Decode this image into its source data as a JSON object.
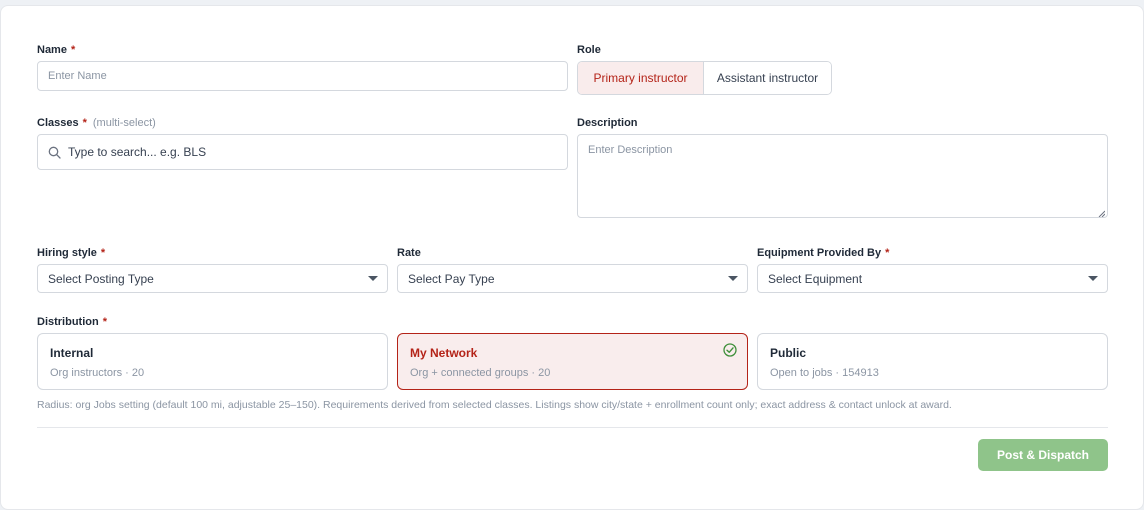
{
  "form": {
    "name": {
      "label": "Name",
      "required": "*",
      "placeholder": "Enter Name"
    },
    "role": {
      "label": "Role",
      "options": [
        "Primary instructor",
        "Assistant instructor"
      ],
      "selected": "Primary instructor"
    },
    "classes": {
      "label": "Classes",
      "required": "*",
      "hint": "(multi-select)",
      "placeholder": "Type to search... e.g. BLS",
      "icon": "search-icon"
    },
    "description": {
      "label": "Description",
      "placeholder": "Enter Description"
    },
    "hiring_style": {
      "label": "Hiring style",
      "required": "*",
      "value": "Select Posting Type"
    },
    "rate": {
      "label": "Rate",
      "value": "Select Pay Type"
    },
    "equipment": {
      "label": "Equipment Provided By",
      "required": "*",
      "value": "Select Equipment"
    },
    "distribution": {
      "label": "Distribution",
      "required": "*",
      "options": [
        {
          "title": "Internal",
          "subtitle": "Org instructors · 20",
          "selected": false
        },
        {
          "title": "My Network",
          "subtitle": "Org + connected groups · 20",
          "selected": true,
          "icon": "check-circle-icon"
        },
        {
          "title": "Public",
          "subtitle": "Open to jobs · 154913",
          "selected": false
        }
      ],
      "note": "Radius: org Jobs setting (default 100 mi, adjustable 25–150). Requirements derived from selected classes. Listings show city/state + enrollment count only; exact address & contact unlock at award."
    },
    "submit_label": "Post & Dispatch"
  },
  "colors": {
    "accent": "#b42318",
    "accent_bg": "#f9ecec",
    "success": "#8fc48a",
    "check": "#3f8f3a"
  }
}
